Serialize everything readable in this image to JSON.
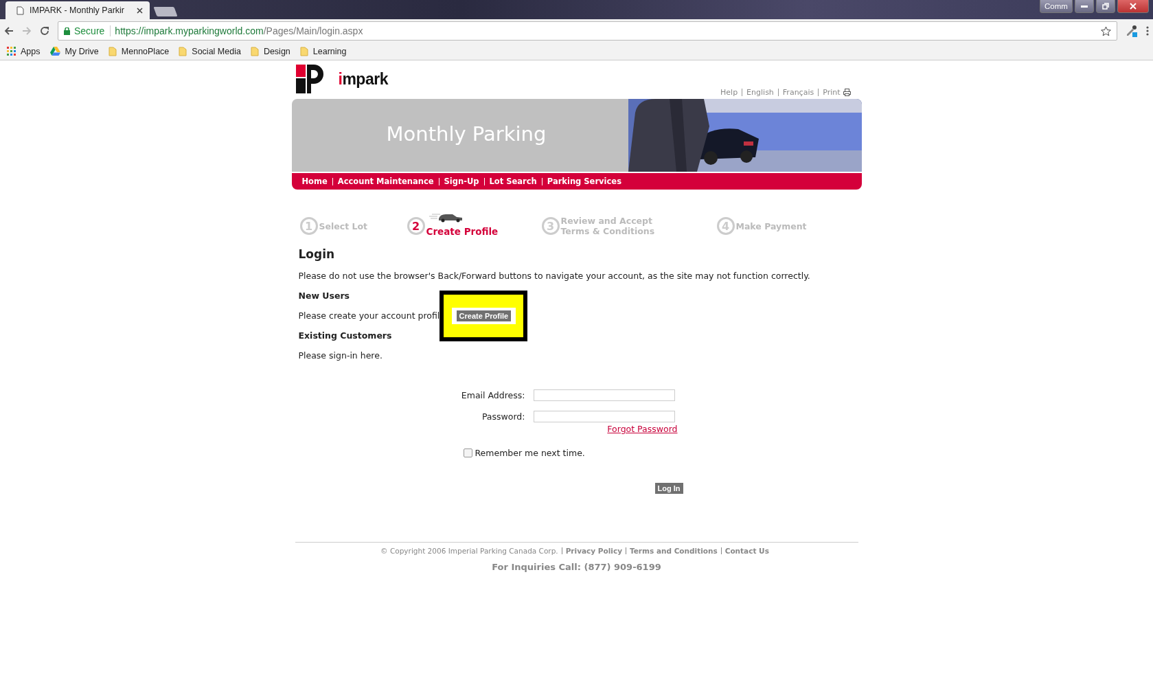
{
  "browser": {
    "tab_title": "IMPARK - Monthly Parkir",
    "window_button": "Comm",
    "secure_label": "Secure",
    "url_host": "https://impark.myparkingworld.com",
    "url_path": "/Pages/Main/login.aspx",
    "bookmarks": [
      {
        "kind": "apps",
        "label": "Apps"
      },
      {
        "kind": "drive",
        "label": "My Drive"
      },
      {
        "kind": "folder",
        "label": "MennoPlace"
      },
      {
        "kind": "folder",
        "label": "Social Media"
      },
      {
        "kind": "folder",
        "label": "Design"
      },
      {
        "kind": "folder",
        "label": "Learning"
      }
    ]
  },
  "header": {
    "logo_text": "impark",
    "utility_links": [
      "Help",
      "English",
      "Français",
      "Print"
    ],
    "banner_title": "Monthly Parking"
  },
  "nav": [
    "Home",
    "Account Maintenance",
    "Sign-Up",
    "Lot Search",
    "Parking Services"
  ],
  "steps": [
    {
      "number": "1",
      "lines": [
        "Select Lot"
      ],
      "selected": false
    },
    {
      "number": "2",
      "lines": [
        "Create Profile"
      ],
      "selected": true
    },
    {
      "number": "3",
      "lines": [
        "Review and Accept",
        "Terms & Conditions"
      ],
      "selected": false
    },
    {
      "number": "4",
      "lines": [
        "Make Payment"
      ],
      "selected": false
    }
  ],
  "login": {
    "title": "Login",
    "warning": "Please do not use the browser's Back/Forward buttons to navigate your account, as the site may not function correctly.",
    "new_users_heading": "New Users",
    "new_users_text": "Please create your account profil",
    "create_button": "Create Profile",
    "existing_heading": "Existing Customers",
    "existing_text": "Please sign-in here.",
    "email_label": "Email Address:",
    "password_label": "Password:",
    "forgot_link": "Forgot Password",
    "remember": {
      "label": "Remember me next time.",
      "checked": false
    },
    "login_button": "Log In"
  },
  "footer": {
    "copyright": "© Copyright 2006 Imperial Parking Canada Corp.",
    "links": [
      "Privacy Policy",
      "Terms and Conditions",
      "Contact Us"
    ],
    "inquiries": "For Inquiries Call: (877) 909-6199"
  }
}
